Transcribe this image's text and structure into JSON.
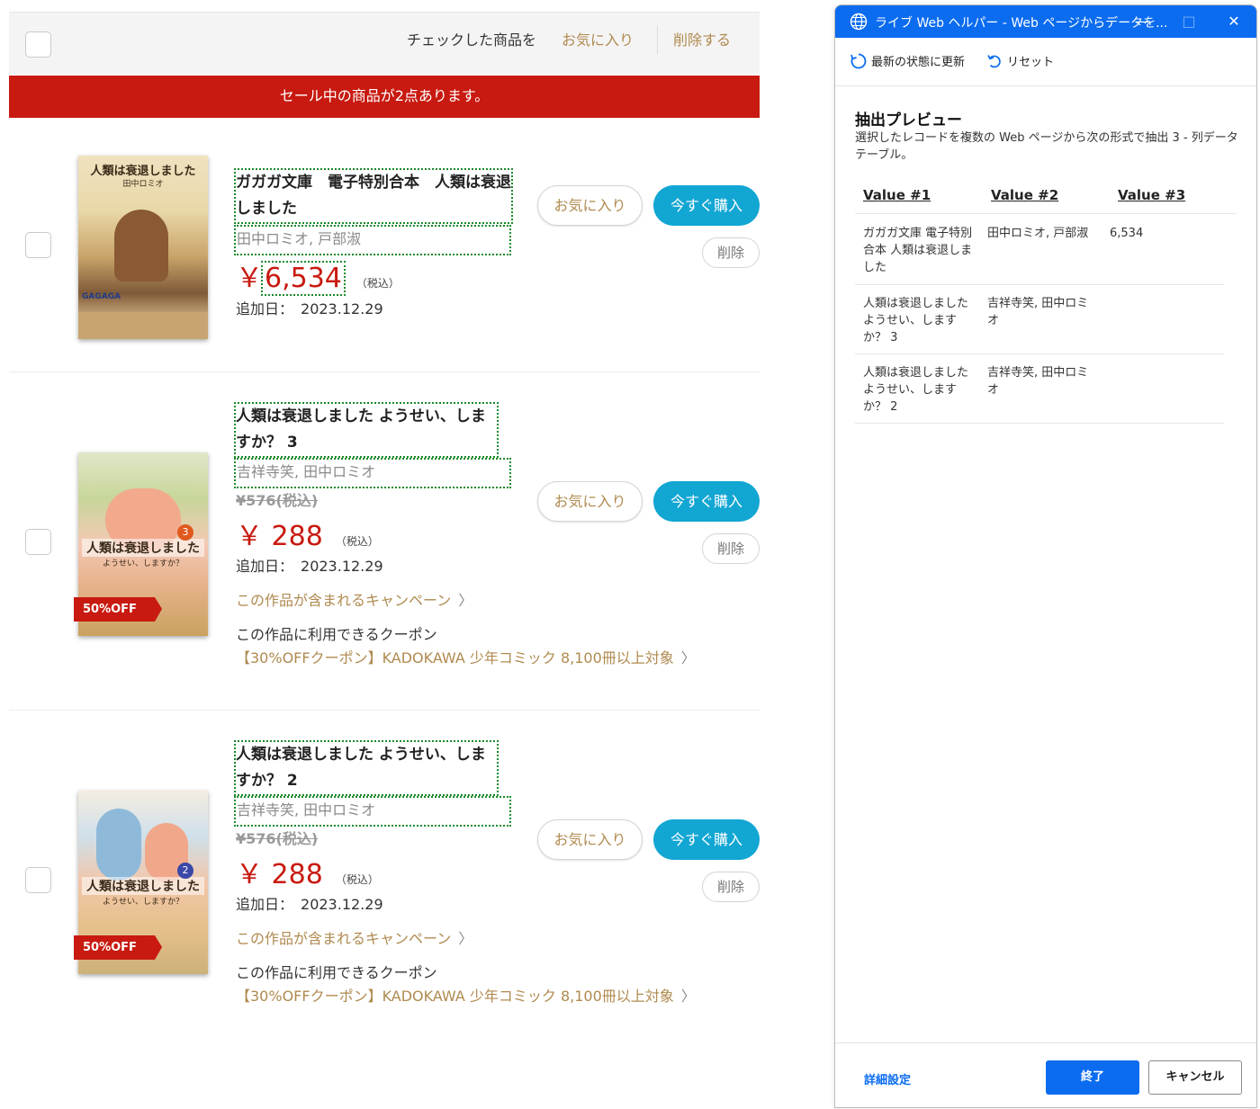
{
  "shop": {
    "bulk": {
      "checked_label": "チェックした商品を",
      "favorite_link": "お気に入り",
      "delete_link": "削除する"
    },
    "sale_banner": "セール中の商品が2点あります。",
    "tax_label": "（税込）",
    "added_label": "追加日：",
    "favorite_button": "お気に入り",
    "buy_button": "今すぐ購入",
    "delete_button": "削除",
    "items": [
      {
        "title": "ガガガ文庫　電子特別合本　人類は衰退しました",
        "author": "田中ロミオ, 戸部淑",
        "currency": "￥",
        "price": "6,534",
        "added_date": "2023.12.29",
        "cover_title": "人類は衰退しました",
        "cover_sub": "田中ロミオ",
        "cover_label": "GAGAGA"
      },
      {
        "title": "人類は衰退しました ようせい、しますか？ 3",
        "author": "吉祥寺笑, 田中ロミオ",
        "old_price": "¥576(税込)",
        "currency": "￥",
        "price": "288",
        "added_date": "2023.12.29",
        "discount_badge": "50%OFF",
        "volume": "3",
        "campaign_link": "この作品が含まれるキャンペーン",
        "coupon_label": "この作品に利用できるクーポン",
        "coupon_link": "【30%OFFクーポン】KADOKAWA 少年コミック 8,100冊以上対象",
        "cover_title": "人類は衰退しました",
        "cover_sub": "ようせい、しますか？"
      },
      {
        "title": "人類は衰退しました ようせい、しますか？ 2",
        "author": "吉祥寺笑, 田中ロミオ",
        "old_price": "¥576(税込)",
        "currency": "￥",
        "price": "288",
        "added_date": "2023.12.29",
        "discount_badge": "50%OFF",
        "volume": "2",
        "campaign_link": "この作品が含まれるキャンペーン",
        "coupon_label": "この作品に利用できるクーポン",
        "coupon_link": "【30%OFFクーポン】KADOKAWA 少年コミック 8,100冊以上対象",
        "cover_title": "人類は衰退しました",
        "cover_sub": "ようせい、しますか？"
      }
    ]
  },
  "helper": {
    "window_title": "ライブ Web ヘルパー - Web ページからデータを...",
    "toolbar": {
      "refresh": "最新の状態に更新",
      "reset": "リセット"
    },
    "preview_title": "抽出プレビュー",
    "preview_desc": "選択したレコードを複数の Web ページから次の形式で抽出 3 - 列データ テーブル。",
    "columns": [
      "Value #1",
      "Value #2",
      "Value #3"
    ],
    "rows": [
      [
        "ガガガ文庫 電子特別合本 人類は衰退しました",
        "田中ロミオ, 戸部淑",
        "6,534"
      ],
      [
        "人類は衰退しました ようせい、しますか？ 3",
        "吉祥寺笑, 田中ロミオ",
        ""
      ],
      [
        "人類は衰退しました ようせい、しますか？ 2",
        "吉祥寺笑, 田中ロミオ",
        ""
      ]
    ],
    "advanced_settings": "詳細設定",
    "finish_button": "終了",
    "cancel_button": "キャンセル"
  },
  "colors": {
    "sale_red": "#c81a10",
    "buy_blue": "#12a6d3",
    "accent_gold": "#b08a4f",
    "window_blue": "#0b6cf0",
    "selection_green": "#1b8a2a"
  }
}
